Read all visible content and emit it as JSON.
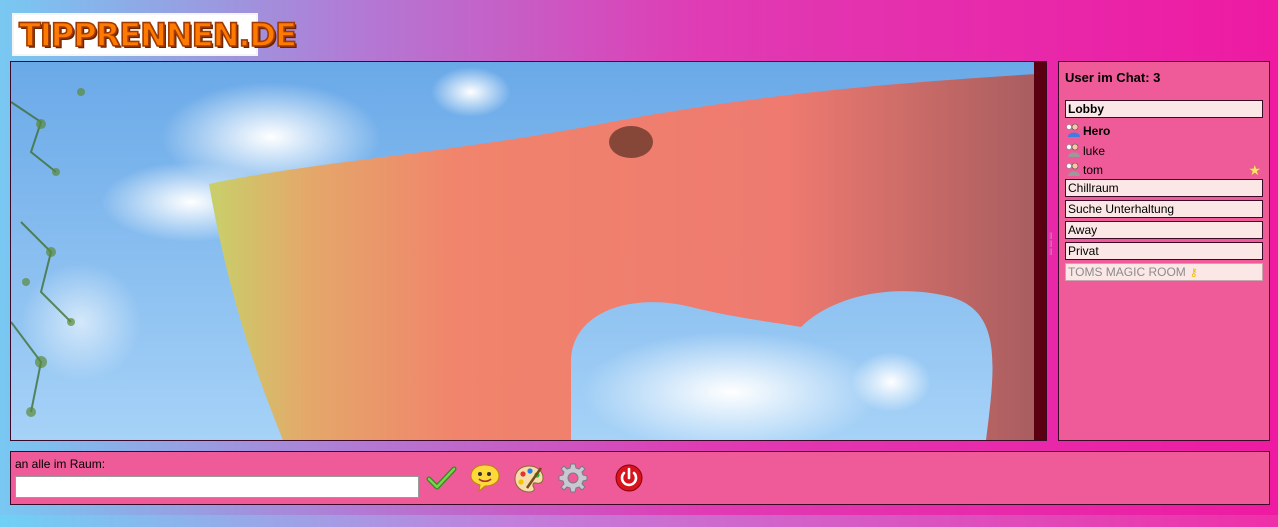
{
  "logo": {
    "text": "TIPPRENNEN.DE"
  },
  "sidebar": {
    "title": "User im Chat: 3",
    "rooms": [
      {
        "name": "Lobby"
      },
      {
        "name": "Chillraum"
      },
      {
        "name": "Suche Unterhaltung"
      },
      {
        "name": "Away"
      },
      {
        "name": "Privat"
      },
      {
        "name": "TOMS MAGIC ROOM"
      }
    ],
    "users": [
      {
        "name": "Hero",
        "icon": "user-icon-blue"
      },
      {
        "name": "luke",
        "icon": "user-icon-grey"
      },
      {
        "name": "tom",
        "icon": "user-icon-grey",
        "badge": "star-icon"
      }
    ]
  },
  "input": {
    "label": "an alle im Raum:",
    "value": "",
    "placeholder": ""
  },
  "toolbar": {
    "buttons": [
      {
        "name": "send",
        "icon": "check-icon"
      },
      {
        "name": "smileys",
        "icon": "smiley-icon"
      },
      {
        "name": "colors",
        "icon": "palette-icon"
      },
      {
        "name": "settings",
        "icon": "gear-icon"
      },
      {
        "name": "logout",
        "icon": "power-icon"
      }
    ]
  },
  "colors": {
    "panel": "#ee5b98",
    "room_bg": "#fbe8e6",
    "border": "#3a0a26"
  }
}
